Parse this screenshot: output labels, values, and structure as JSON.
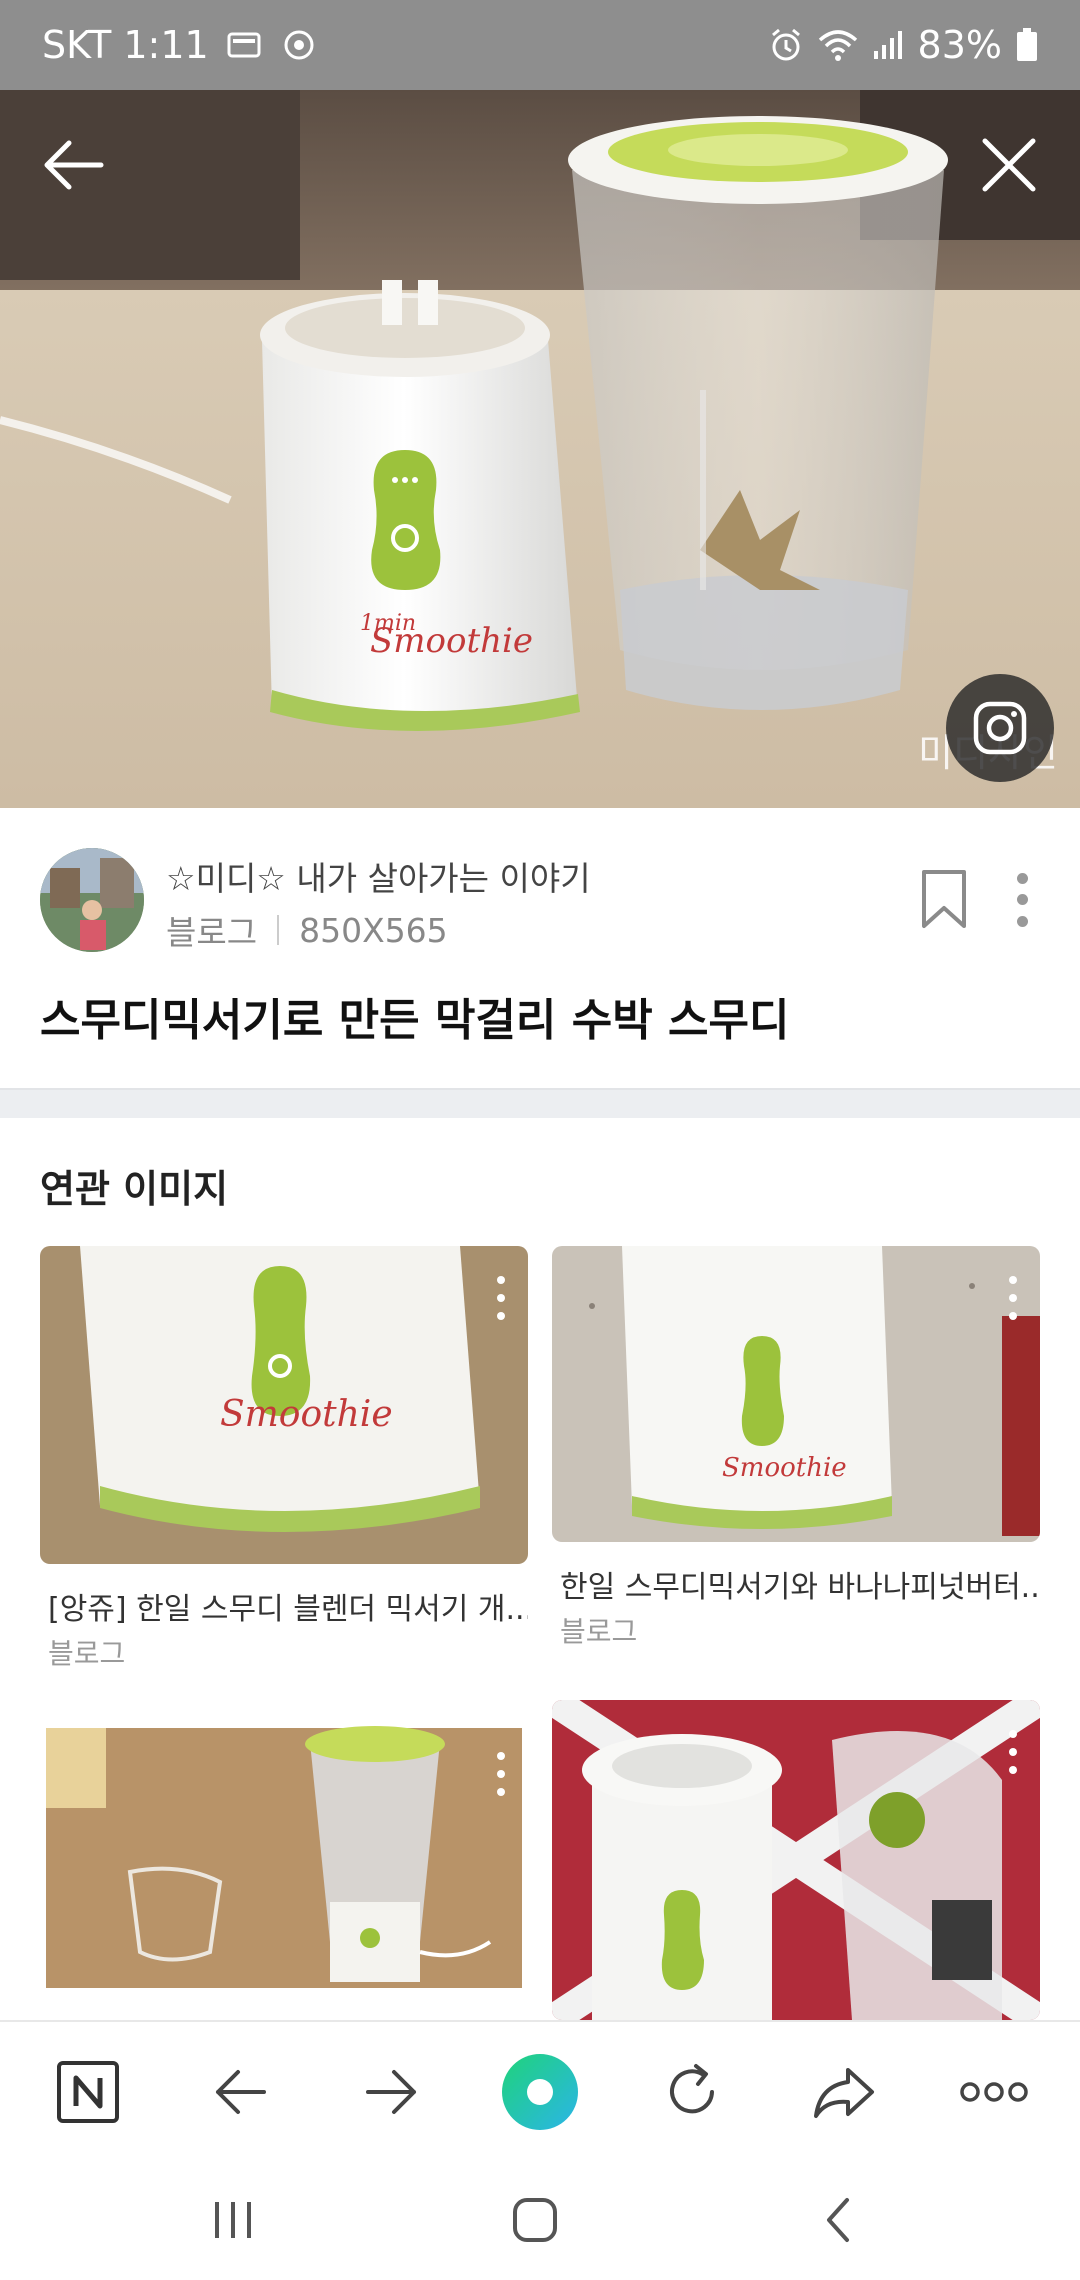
{
  "status_bar": {
    "carrier_time": "SKT 1:11",
    "battery": "83%",
    "icons": [
      "sim-card-icon",
      "sync-icon",
      "alarm-icon",
      "wifi-icon",
      "signal-icon",
      "battery-icon"
    ]
  },
  "hero": {
    "watermark": "미디자인",
    "image_subject": "smoothie blender",
    "label_brand": "Smoothie",
    "label_min": "1min"
  },
  "post": {
    "blog_name": "☆미디☆ 내가 살아가는 이야기",
    "source": "블로그",
    "dimensions": "850X565",
    "title": "스무디믹서기로 만든 막걸리 수박 스무디"
  },
  "related": {
    "heading": "연관 이미지",
    "cards": [
      {
        "caption": "[앙쥬] 한일 스무디 블렌더 믹서기 개...",
        "source": "블로그"
      },
      {
        "caption": "한일 스무디믹서기와 바나나피넛버터...",
        "source": "블로그"
      },
      {
        "caption": "",
        "source": ""
      },
      {
        "caption": "",
        "source": ""
      }
    ]
  },
  "toolbar": {
    "items": [
      "naver-home-icon",
      "back-arrow-icon",
      "forward-arrow-icon",
      "green-dot-icon",
      "refresh-icon",
      "share-icon",
      "more-icon"
    ],
    "accent": "#2fd38c"
  },
  "system_nav": {
    "items": [
      "recent-apps-icon",
      "home-icon",
      "back-icon"
    ]
  }
}
